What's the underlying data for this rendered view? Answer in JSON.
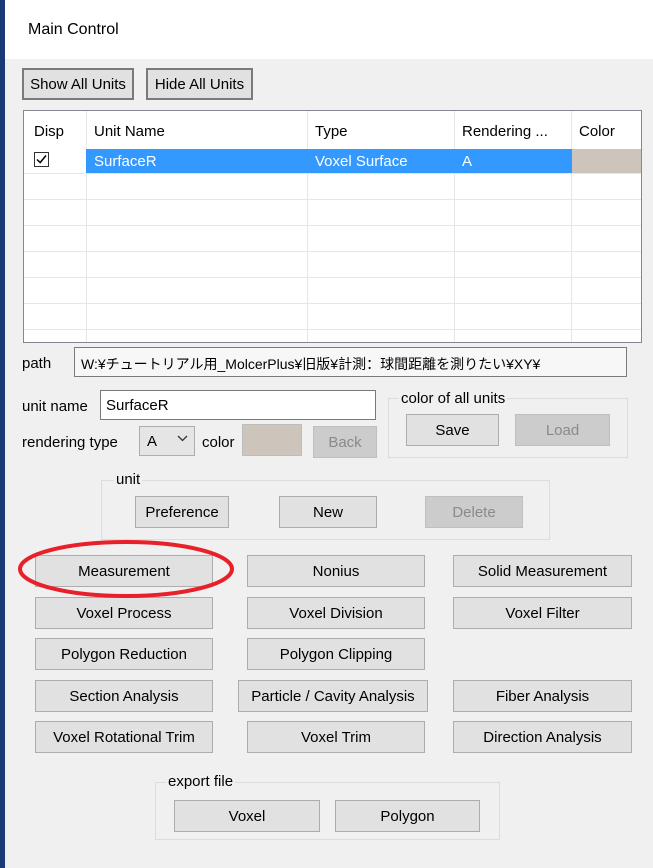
{
  "window": {
    "title": "Main Control"
  },
  "toolbar": {
    "show_all_units": "Show All Units",
    "hide_all_units": "Hide All Units"
  },
  "unit_list": {
    "columns": [
      "Disp",
      "Unit Name",
      "Type",
      "Rendering ...",
      "Color"
    ],
    "rows": [
      {
        "disp_checked": true,
        "unit_name": "SurfaceR",
        "type": "Voxel Surface",
        "rendering": "A",
        "color": "#cdc5bb"
      }
    ]
  },
  "path": {
    "label": "path",
    "value": "W:¥チュートリアル用_MolcerPlus¥旧版¥計測：球間距離を測りたい¥XY¥"
  },
  "unit_name": {
    "label": "unit name",
    "value": "SurfaceR"
  },
  "rendering": {
    "label": "rendering type",
    "value": "A",
    "color_label": "color",
    "color_value": "#cdc5bb",
    "back_label": "Back"
  },
  "color_all": {
    "group_label": "color of all units",
    "save_label": "Save",
    "load_label": "Load"
  },
  "unit_group": {
    "label": "unit",
    "preference_label": "Preference",
    "new_label": "New",
    "delete_label": "Delete"
  },
  "tools": {
    "measurement": "Measurement",
    "nonius": "Nonius",
    "solid_measurement": "Solid Measurement",
    "voxel_process": "Voxel Process",
    "voxel_division": "Voxel Division",
    "voxel_filter": "Voxel Filter",
    "polygon_reduction": "Polygon Reduction",
    "polygon_clipping": "Polygon Clipping",
    "section_analysis": "Section Analysis",
    "particle_cavity": "Particle / Cavity Analysis",
    "fiber_analysis": "Fiber Analysis",
    "voxel_rotational_trim": "Voxel Rotational Trim",
    "voxel_trim": "Voxel Trim",
    "direction_analysis": "Direction Analysis"
  },
  "export": {
    "group_label": "export file",
    "voxel_label": "Voxel",
    "polygon_label": "Polygon"
  },
  "colors": {
    "selection": "#3399ff",
    "highlight_ellipse": "#e8202a",
    "window_edge": "#1a3a75"
  }
}
